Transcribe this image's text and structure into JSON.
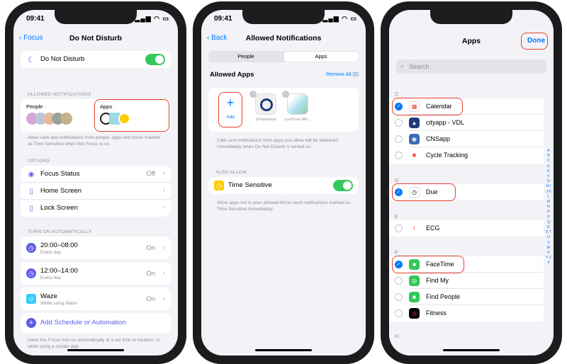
{
  "status": {
    "time": "09:41",
    "icons": "▂▄▆ ◠ ▭"
  },
  "phone1": {
    "back": "Focus",
    "title": "Do Not Disturb",
    "dnd_label": "Do Not Disturb",
    "allowed_header": "ALLOWED NOTIFICATIONS",
    "people_label": "People",
    "apps_label": "Apps",
    "allowed_footer": "Allow calls and notifications from people, apps and those marked as Time Sensitive when this Focus is on.",
    "options_header": "OPTIONS",
    "options": [
      {
        "label": "Focus Status",
        "value": "Off"
      },
      {
        "label": "Home Screen",
        "value": ""
      },
      {
        "label": "Lock Screen",
        "value": ""
      }
    ],
    "auto_header": "TURN ON AUTOMATICALLY",
    "schedules": [
      {
        "label": "20:00–08:00",
        "sub": "Every day",
        "value": "On"
      },
      {
        "label": "12:00–14:00",
        "sub": "Every day",
        "value": "On"
      },
      {
        "label": "Waze",
        "sub": "While using Waze",
        "value": "On"
      }
    ],
    "add_schedule": "Add Schedule or Automation",
    "auto_footer": "Have this Focus turn on automatically at a set time or location, or while using a certain app."
  },
  "phone2": {
    "back": "Back",
    "title": "Allowed Notifications",
    "tabs": [
      "People",
      "Apps"
    ],
    "allowed_apps": "Allowed Apps",
    "remove_all": "Remove All (2)",
    "add_label": "Add",
    "apps": [
      "1Password",
      "LuxTrust Mo..."
    ],
    "apps_footer": "Calls and notifications from apps you allow will be delivered immediately when Do Not Disturb is turned on.",
    "also_allow": "ALSO ALLOW",
    "time_sensitive": "Time Sensitive",
    "ts_footer": "Allow apps not in your allowed list to send notifications marked as Time Sensitive immediately."
  },
  "phone3": {
    "title": "Apps",
    "done": "Done",
    "search_placeholder": "Search",
    "sections": [
      {
        "letter": "C",
        "apps": [
          {
            "name": "Calendar",
            "checked": true
          },
          {
            "name": "cityapp - VDL",
            "checked": false
          },
          {
            "name": "CNSapp",
            "checked": false
          },
          {
            "name": "Cycle Tracking",
            "checked": false
          }
        ]
      },
      {
        "letter": "D",
        "apps": [
          {
            "name": "Due",
            "checked": true
          }
        ]
      },
      {
        "letter": "E",
        "apps": [
          {
            "name": "ECG",
            "checked": false
          }
        ]
      },
      {
        "letter": "F",
        "apps": [
          {
            "name": "FaceTime",
            "checked": true
          },
          {
            "name": "Find My",
            "checked": false
          },
          {
            "name": "Find People",
            "checked": false
          },
          {
            "name": "Fitness",
            "checked": false
          }
        ]
      },
      {
        "letter": "H",
        "apps": []
      }
    ],
    "alphabet": "A B C D E F G H I J K L M N O P Q R S T U V W X Y Z #"
  },
  "colors": {
    "blue": "#007aff",
    "green": "#34c759",
    "red_box": "#e8412c",
    "purple": "#5e5ce6"
  }
}
